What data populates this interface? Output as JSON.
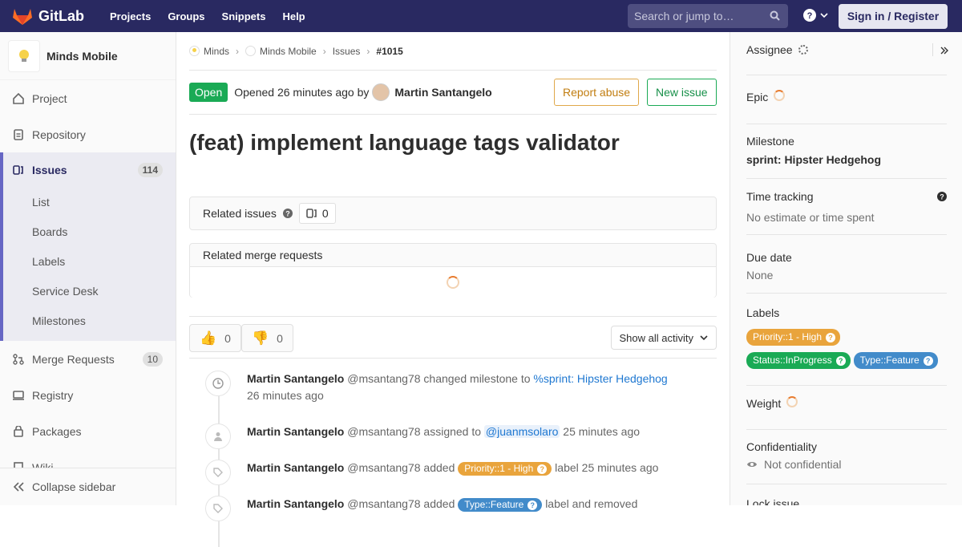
{
  "topbar": {
    "brand": "GitLab",
    "nav": [
      "Projects",
      "Groups",
      "Snippets",
      "Help"
    ],
    "search_placeholder": "Search or jump to…",
    "signin": "Sign in / Register"
  },
  "sidebar": {
    "project": "Minds Mobile",
    "items": [
      {
        "label": "Project",
        "icon": "home-icon"
      },
      {
        "label": "Repository",
        "icon": "doc-icon"
      },
      {
        "label": "Issues",
        "icon": "issues-icon",
        "count": "114"
      },
      {
        "label": "Merge Requests",
        "icon": "merge-icon",
        "count": "10"
      },
      {
        "label": "Registry",
        "icon": "registry-icon"
      },
      {
        "label": "Packages",
        "icon": "package-icon"
      },
      {
        "label": "Wiki",
        "icon": "book-icon"
      }
    ],
    "sub": [
      "List",
      "Boards",
      "Labels",
      "Service Desk",
      "Milestones"
    ],
    "collapse": "Collapse sidebar"
  },
  "breadcrumb": [
    "Minds",
    "Minds Mobile",
    "Issues",
    "#1015"
  ],
  "issue": {
    "status": "Open",
    "opened_text": "Opened 26 minutes ago by",
    "author": "Martin Santangelo",
    "report_btn": "Report abuse",
    "new_btn": "New issue",
    "title": "(feat) implement language tags validator",
    "related_label": "Related issues",
    "related_count": "0",
    "mr_label": "Related merge requests",
    "thumbs_up": "0",
    "thumbs_down": "0",
    "filter": "Show all activity"
  },
  "notes": [
    {
      "name": "Martin Santangelo",
      "user": "@msantang78",
      "action": "changed milestone to",
      "link": "%sprint: Hipster Hedgehog",
      "time": "26 minutes ago"
    },
    {
      "name": "Martin Santangelo",
      "user": "@msantang78",
      "action": "assigned to",
      "mention": "@juanmsolaro",
      "time": "25 minutes ago"
    },
    {
      "name": "Martin Santangelo",
      "user": "@msantang78",
      "action": "added",
      "label": "Priority::1 - High",
      "after": "label",
      "time": "25 minutes ago"
    },
    {
      "name": "Martin Santangelo",
      "user": "@msantang78",
      "action": "added",
      "label": "Type::Feature",
      "after": "label and removed"
    }
  ],
  "right": {
    "assignee": "Assignee",
    "epic": "Epic",
    "milestone": "Milestone",
    "milestone_value": "sprint: Hipster Hedgehog",
    "time_tracking": "Time tracking",
    "time_value": "No estimate or time spent",
    "due": "Due date",
    "due_value": "None",
    "labels": "Labels",
    "label_list": [
      "Priority::1 - High",
      "Status::InProgress",
      "Type::Feature"
    ],
    "weight": "Weight",
    "conf": "Confidentiality",
    "conf_value": "Not confidential",
    "lock": "Lock issue"
  },
  "colors": {
    "topbar": "#292961",
    "open": "#1aaa55",
    "priority": "#e9a43c",
    "status": "#1aaa55",
    "feature": "#428bca"
  }
}
